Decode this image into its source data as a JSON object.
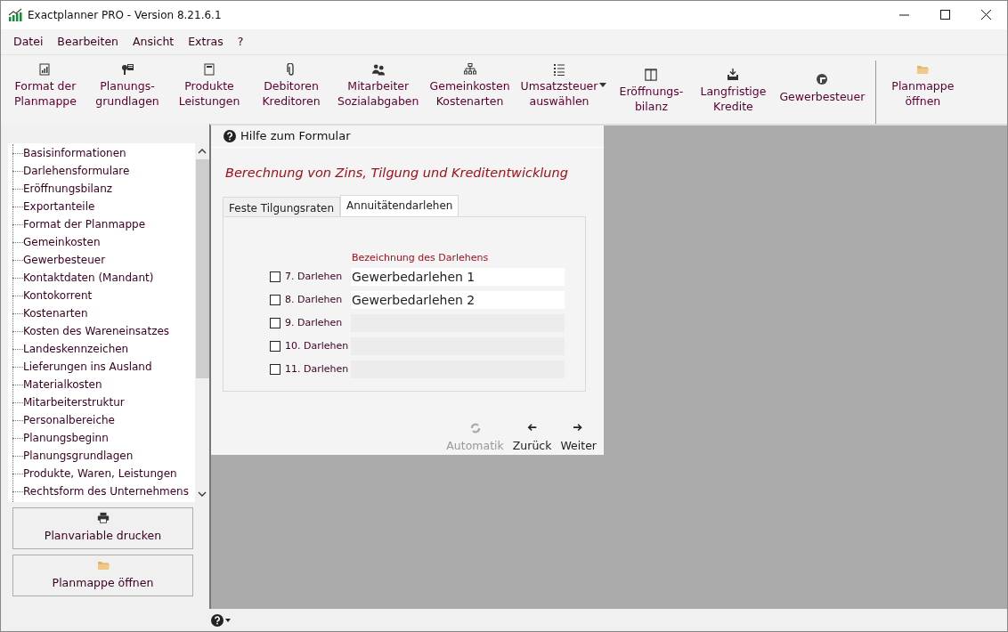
{
  "window": {
    "title": "Exactplanner PRO - Version 8.21.6.1"
  },
  "menu": [
    "Datei",
    "Bearbeiten",
    "Ansicht",
    "Extras",
    "?"
  ],
  "toolbar": [
    {
      "kind": "report",
      "label": "Format der\nPlanmappe"
    },
    {
      "kind": "key",
      "label": "Planungs-\ngrundlagen"
    },
    {
      "kind": "notebook",
      "label": "Produkte\nLeistungen"
    },
    {
      "kind": "clip",
      "label": "Debitoren\nKreditoren"
    },
    {
      "kind": "people",
      "label": "Mitarbeiter\nSozialabgaben"
    },
    {
      "kind": "org",
      "label": "Gemeinkosten\nKostenarten"
    },
    {
      "kind": "list",
      "label": "Umsatzsteuer\nauswählen",
      "dropdown": true
    },
    {
      "kind": "columns",
      "label": "Eröffnungs-\nbilanz"
    },
    {
      "kind": "download",
      "label": "Langfristige\nKredite"
    },
    {
      "kind": "badge",
      "label": "Gewerbesteuer"
    },
    {
      "kind": "folder",
      "label": "Planmappe\nöffnen",
      "separated": true
    }
  ],
  "sidebar": {
    "items": [
      "Basisinformationen",
      "Darlehensformulare",
      "Eröffnungsbilanz",
      "Exportanteile",
      "Format der Planmappe",
      "Gemeinkosten",
      "Gewerbesteuer",
      "Kontaktdaten (Mandant)",
      "Kontokorrent",
      "Kostenarten",
      "Kosten des Wareneinsatzes",
      "Landeskennzeichen",
      "Lieferungen ins Ausland",
      "Materialkosten",
      "Mitarbeiterstruktur",
      "Personalbereiche",
      "Planungsbeginn",
      "Planungsgrundlagen",
      "Produkte, Waren, Leistungen",
      "Rechtsform des Unternehmens"
    ],
    "buttons": [
      {
        "kind": "printer",
        "label": "Planvariable drucken"
      },
      {
        "kind": "folder",
        "label": "Planmappe öffnen"
      }
    ]
  },
  "form": {
    "help": "Hilfe zum Formular",
    "heading": "Berechnung von Zins, Tilgung und Kreditentwicklung",
    "tabs": [
      {
        "label": "Feste Tilgungsraten",
        "selected": false
      },
      {
        "label": "Annuitätendarlehen",
        "selected": true
      }
    ],
    "column_label": "Bezeichnung des Darlehens",
    "loans": [
      {
        "label": "7. Darlehen",
        "checked": false,
        "value": "Gewerbedarlehen 1",
        "disabled": false
      },
      {
        "label": "8. Darlehen",
        "checked": false,
        "value": "Gewerbedarlehen 2",
        "disabled": false
      },
      {
        "label": "9. Darlehen",
        "checked": false,
        "disabled": true
      },
      {
        "label": "10. Darlehen",
        "checked": false,
        "disabled": true
      },
      {
        "label": "11. Darlehen",
        "checked": false,
        "disabled": true
      }
    ],
    "actions": [
      {
        "kind": "refresh",
        "label": "Automatik",
        "disabled": true
      },
      {
        "kind": "back",
        "label": "Zurück",
        "disabled": false
      },
      {
        "kind": "forward",
        "label": "Weiter",
        "disabled": false
      }
    ]
  }
}
